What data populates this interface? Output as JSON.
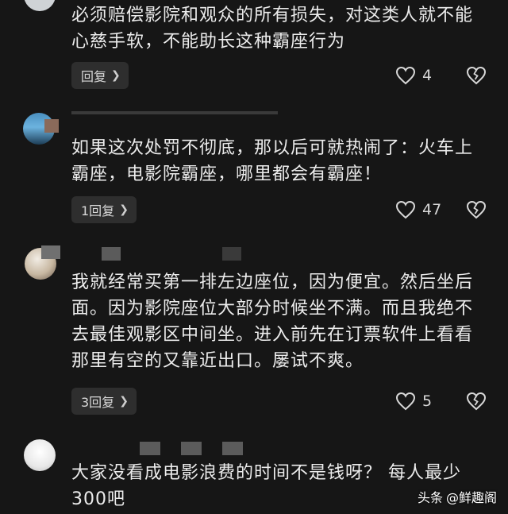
{
  "comments": [
    {
      "text": "必须赔偿影院和观众的所有损失，对这类人就不能\n心慈手软，不能助长这种霸座行为",
      "reply_label": "回复",
      "likes": "4"
    },
    {
      "text": "如果这次处罚不彻底，那以后可就热闹了：火车上\n霸座，电影院霸座，哪里都会有霸座！",
      "reply_label": "1回复",
      "likes": "47"
    },
    {
      "text": "我就经常买第一排左边座位，因为便宜。然后坐后\n面。因为影院座位大部分时候坐不满。而且我绝不\n去最佳观影区中间坐。进入前先在订票软件上看看\n那里有空的又靠近出口。屡试不爽。",
      "reply_label": "3回复",
      "likes": "5"
    },
    {
      "text": "大家没看成电影浪费的时间不是钱呀？ 每人最少\n300吧"
    }
  ],
  "watermark": {
    "brand": "头条",
    "handle": "@鲜趣阁"
  },
  "icons": {
    "like": "heart-outline-icon",
    "dislike": "broken-heart-icon",
    "reply_chevron": "chevron-right-icon"
  }
}
